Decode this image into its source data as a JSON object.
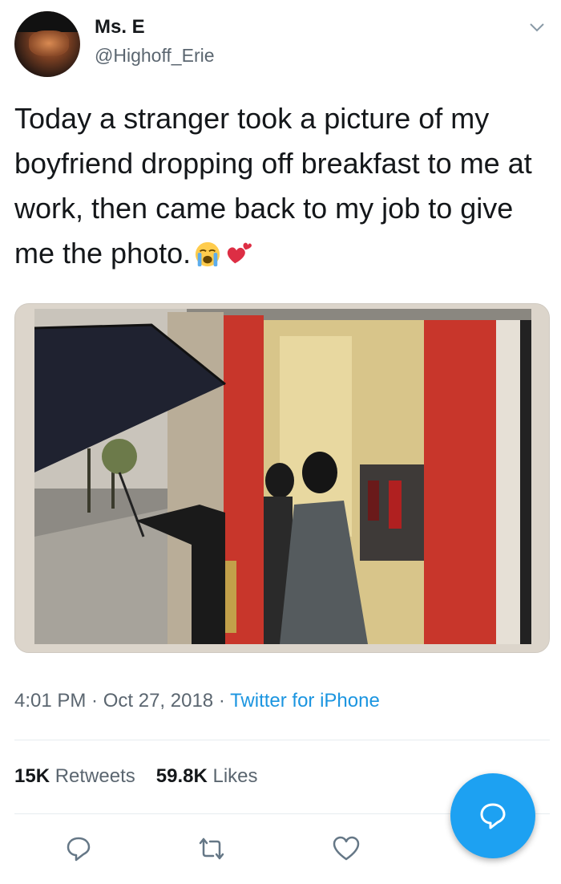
{
  "author": {
    "name": "Ms. E",
    "handle": "@Highoff_Erie"
  },
  "tweet": {
    "text": "Today a stranger took a picture of my boyfriend dropping off breakfast to me at work, then came back to my job to give me the photo."
  },
  "meta": {
    "time": "4:01 PM",
    "separator": " · ",
    "date": "Oct 27, 2018",
    "source": "Twitter for iPhone"
  },
  "stats": {
    "retweets_count": "15K",
    "retweets_label": "Retweets",
    "likes_count": "59.8K",
    "likes_label": "Likes"
  },
  "icons": {
    "more": "chevron-down-icon",
    "reply": "reply-icon",
    "retweet": "retweet-icon",
    "like": "heart-icon",
    "compose": "compose-reply-icon"
  },
  "colors": {
    "link": "#1b95e0",
    "fab": "#1da1f2",
    "secondary_text": "#5b6670"
  }
}
